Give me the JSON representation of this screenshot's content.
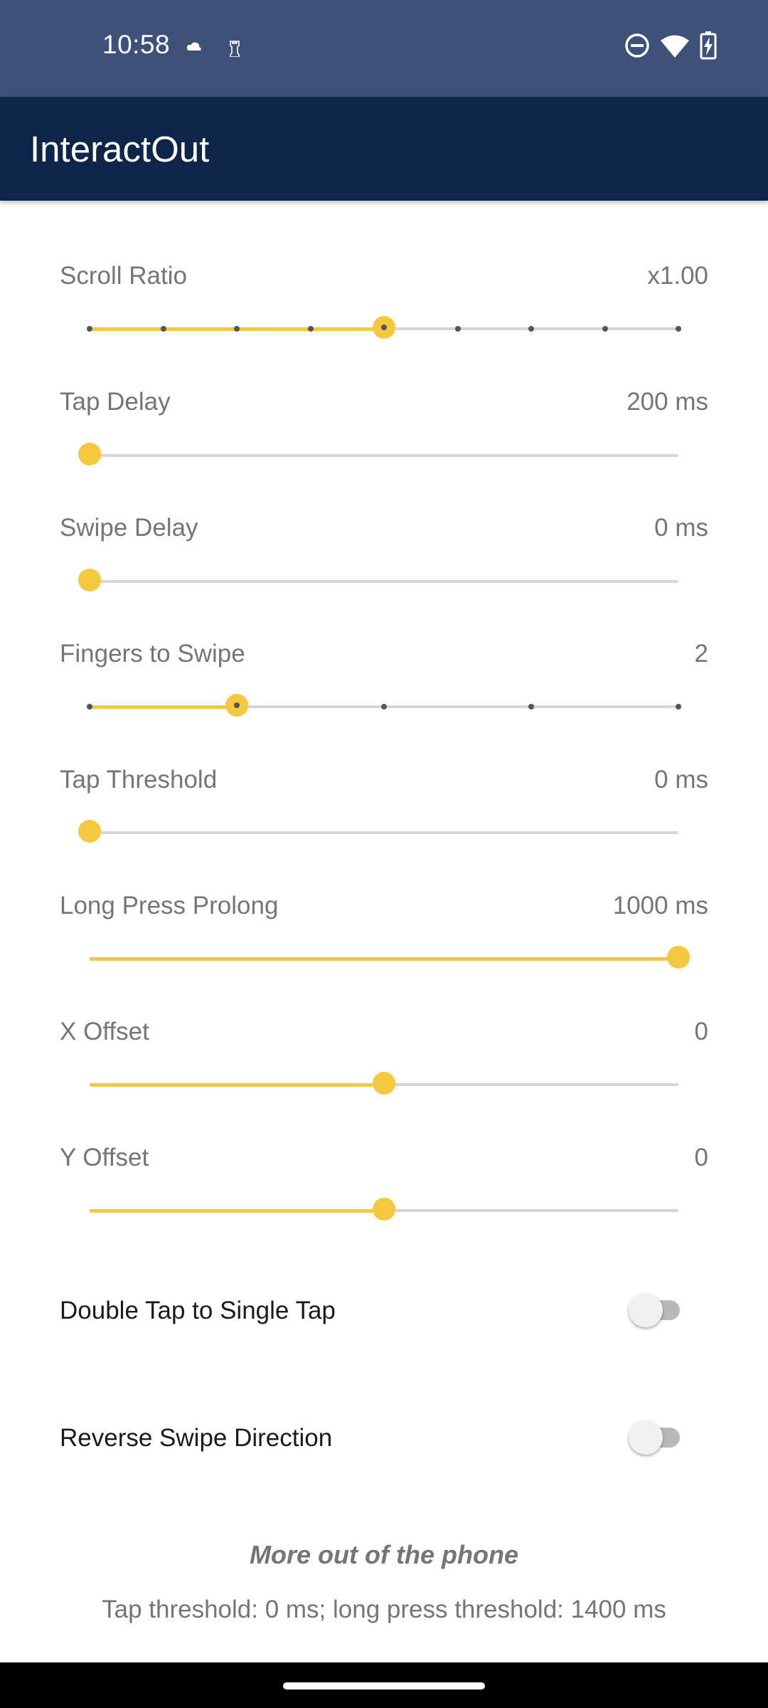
{
  "status_bar": {
    "time": "10:58",
    "left_icons": [
      "cloud-icon",
      "chess-rook-icon"
    ],
    "right_icons": [
      "do-not-disturb-icon",
      "wifi-icon",
      "battery-charging-icon"
    ]
  },
  "app_bar": {
    "title": "InteractOut"
  },
  "colors": {
    "accent": "#f4c93f",
    "app_bar": "#0d2549",
    "status_bar": "#3e5178"
  },
  "settings": [
    {
      "label": "Scroll Ratio",
      "value": "x1.00",
      "level": 0.5,
      "steps": 8
    },
    {
      "label": "Tap Delay",
      "value": "200 ms",
      "level": 0,
      "steps": 0
    },
    {
      "label": "Swipe Delay",
      "value": "0 ms",
      "level": 0,
      "steps": 0
    },
    {
      "label": "Fingers to Swipe",
      "value": "2",
      "level": 0.25,
      "steps": 4
    },
    {
      "label": "Tap Threshold",
      "value": "0 ms",
      "level": 0,
      "steps": 0
    },
    {
      "label": "Long Press Prolong",
      "value": "1000 ms",
      "level": 1,
      "steps": 0
    },
    {
      "label": "X Offset",
      "value": "0",
      "level": 0.5,
      "steps": 0
    },
    {
      "label": "Y Offset",
      "value": "0",
      "level": 0.5,
      "steps": 0
    }
  ],
  "toggles": [
    {
      "label": "Double Tap to Single Tap",
      "on": false
    },
    {
      "label": "Reverse Swipe Direction",
      "on": false
    }
  ],
  "footer": {
    "tagline": "More out of the phone",
    "info": "Tap threshold: 0 ms; long press threshold: 1400 ms"
  }
}
